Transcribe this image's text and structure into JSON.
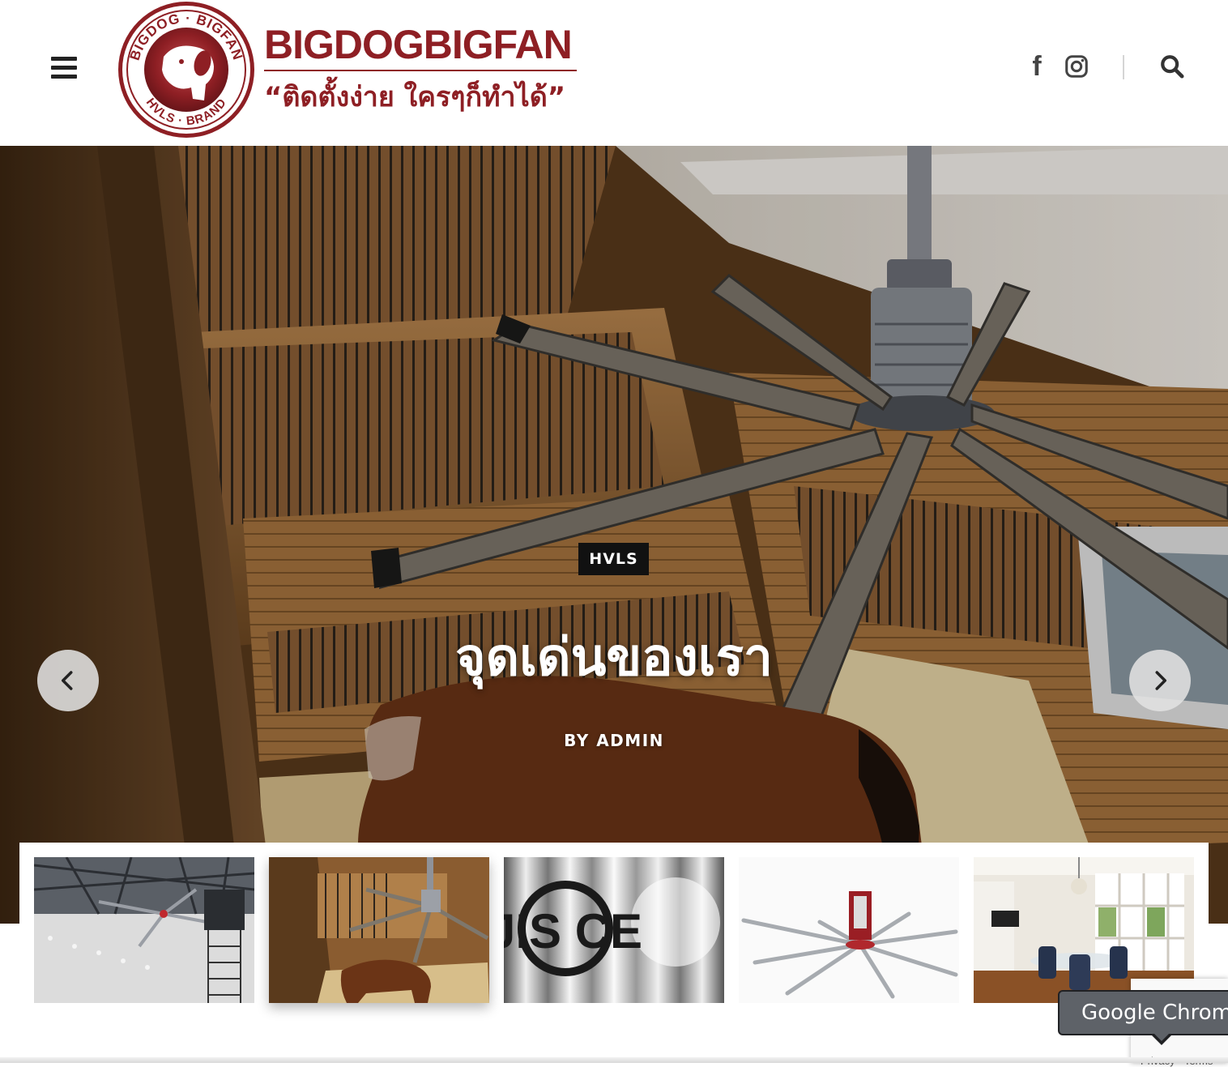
{
  "header": {
    "logo": {
      "brand": "BIGDOGBIGFAN",
      "tagline": "“ติดตั้งง่าย ใครๆก็ทำได้”",
      "seal_text_top": "BIGDOG · BIGFAN",
      "seal_text_bottom": "HVLS · BRAND",
      "brand_color": "#8e1f24"
    },
    "icons": [
      "menu-icon",
      "facebook-icon",
      "instagram-icon",
      "search-icon"
    ],
    "facebook_glyph": "f"
  },
  "hero": {
    "category": "HVLS",
    "title": "จุดเด่นของเรา",
    "author": "BY ADMIN",
    "prev_icon": "chevron-left-icon",
    "next_icon": "chevron-right-icon"
  },
  "thumbnails": [
    {
      "subject": "warehouse-fan",
      "active": false
    },
    {
      "subject": "horse-stable-fan",
      "active": true
    },
    {
      "subject": "jis-ce-certification",
      "active": false
    },
    {
      "subject": "fan-product",
      "active": false
    },
    {
      "subject": "dining-room-fan",
      "active": false
    }
  ],
  "thumbnail_text": {
    "certification": "JIS CE"
  },
  "recaptcha": {
    "links": "Privacy - Terms"
  },
  "tooltip": {
    "text": "Google Chrome"
  }
}
